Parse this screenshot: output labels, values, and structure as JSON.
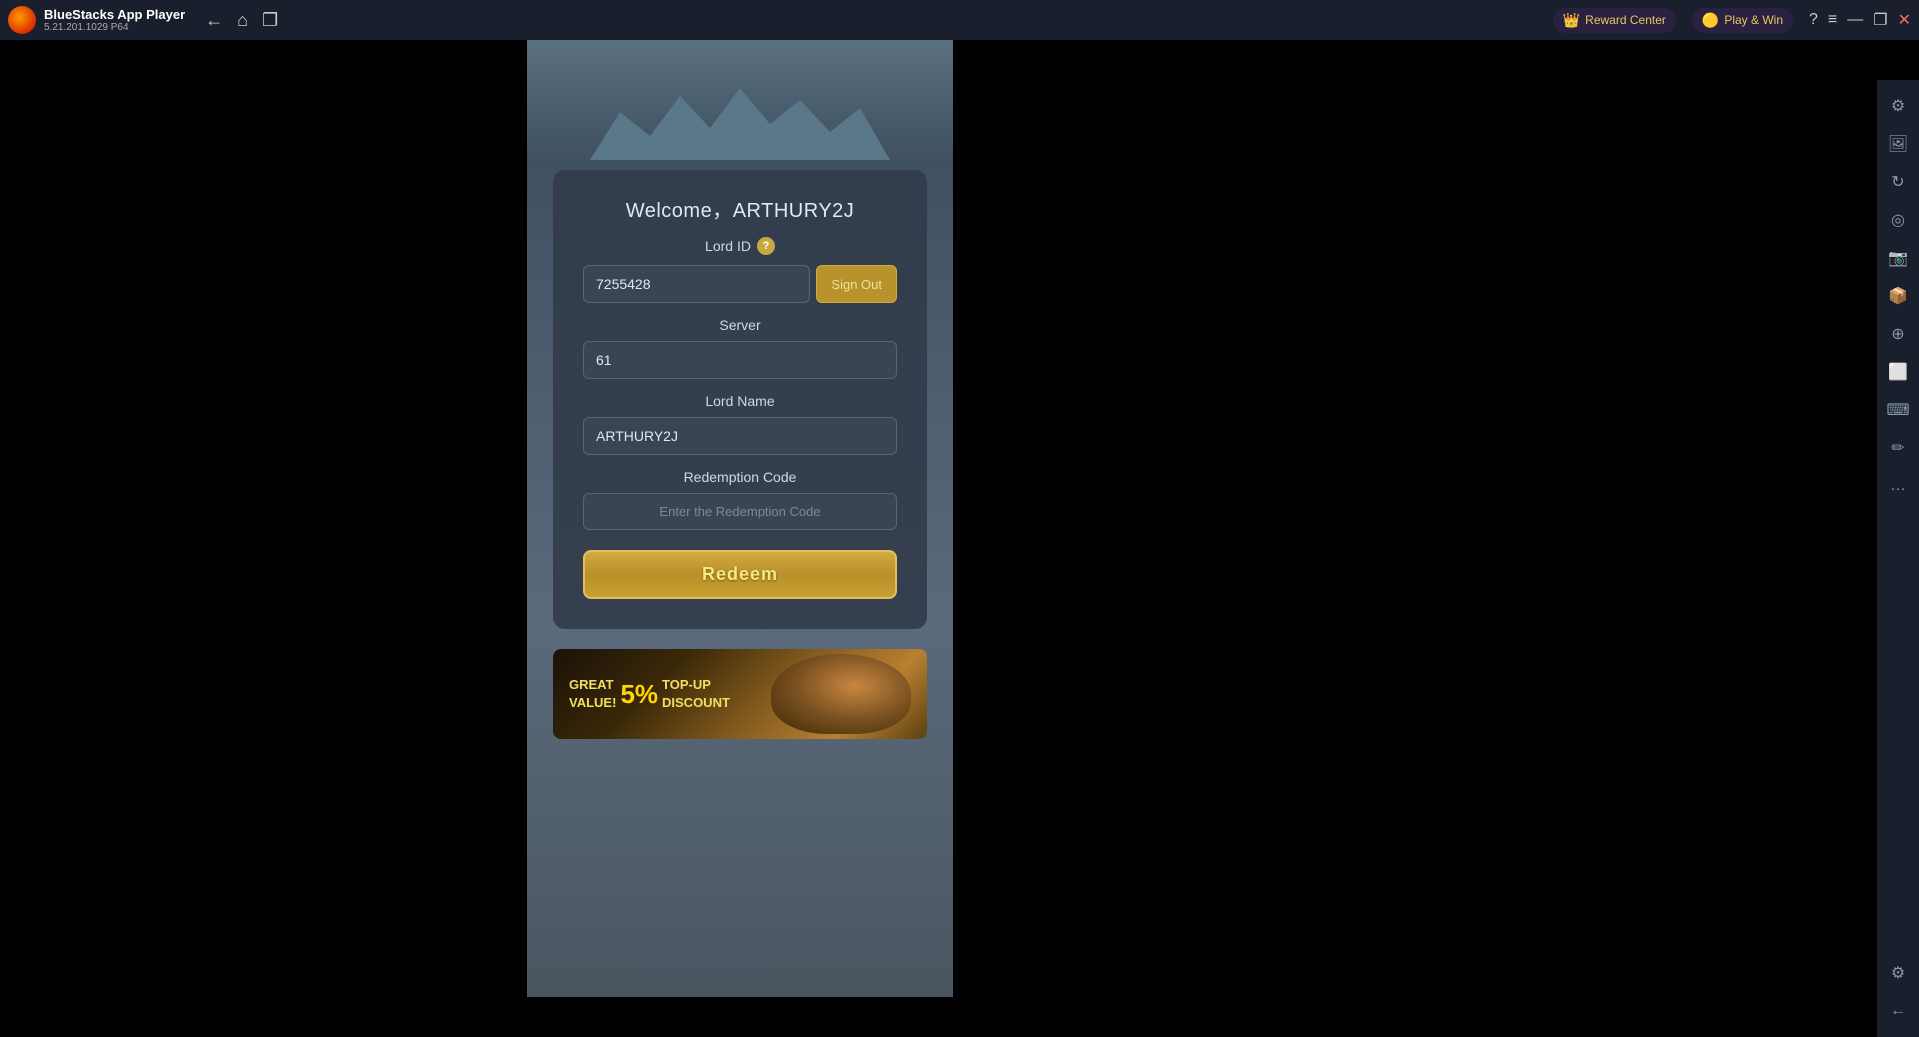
{
  "titlebar": {
    "app_name": "BlueStacks App Player",
    "version": "5.21.201.1029  P64",
    "nav": {
      "back_label": "←",
      "home_label": "⌂",
      "multi_label": "❐"
    },
    "reward_center": "Reward Center",
    "play_win": "Play & Win",
    "help_label": "?",
    "menu_label": "≡",
    "minimize_label": "—",
    "maximize_label": "❐",
    "close_label": "✕"
  },
  "game": {
    "welcome": "Welcome，ARTHURY2J",
    "lord_id_label": "Lord ID",
    "lord_id_value": "7255428",
    "sign_out_label": "Sign Out",
    "server_label": "Server",
    "server_value": "61",
    "lord_name_label": "Lord Name",
    "lord_name_value": "ARTHURY2J",
    "redemption_code_label": "Redemption Code",
    "redemption_code_placeholder": "Enter the Redemption Code",
    "redeem_button": "Redeem",
    "banner": {
      "great_value": "GREAT",
      "value_label": "VALUE!",
      "percent": "5%",
      "top_up": "TOP-UP",
      "discount": "DISCOUNT"
    }
  },
  "sidebar": {
    "icons": [
      {
        "name": "settings-icon",
        "glyph": "⚙"
      },
      {
        "name": "photo-icon",
        "glyph": "🖼"
      },
      {
        "name": "rotate-icon",
        "glyph": "↻"
      },
      {
        "name": "location-icon",
        "glyph": "◎"
      },
      {
        "name": "camera-icon",
        "glyph": "📷"
      },
      {
        "name": "apk-icon",
        "glyph": "📦"
      },
      {
        "name": "zoom-icon",
        "glyph": "⊕"
      },
      {
        "name": "screenshot-icon",
        "glyph": "⬜"
      },
      {
        "name": "keyboard-icon",
        "glyph": "⌨"
      },
      {
        "name": "script-icon",
        "glyph": "✏"
      },
      {
        "name": "more-icon",
        "glyph": "…"
      },
      {
        "name": "config-icon",
        "glyph": "⚙"
      },
      {
        "name": "back-icon",
        "glyph": "←"
      }
    ]
  }
}
